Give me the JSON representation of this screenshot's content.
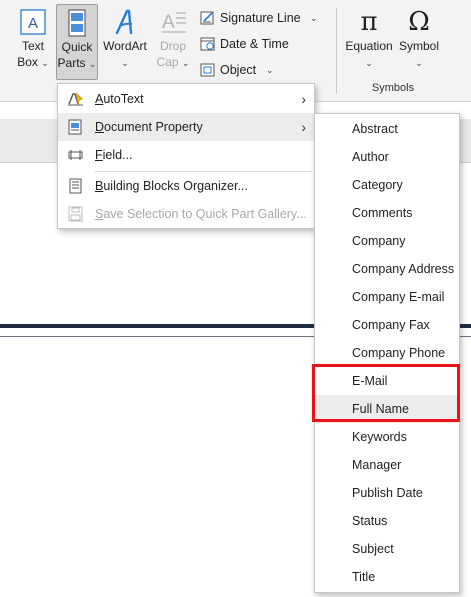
{
  "ribbon": {
    "text_box": {
      "line1": "Text",
      "line2": "Box"
    },
    "quick_parts": {
      "line1": "Quick",
      "line2": "Parts"
    },
    "wordart": {
      "label": "WordArt"
    },
    "drop_cap": {
      "line1": "Drop",
      "line2": "Cap"
    },
    "signature_line": "Signature Line",
    "date_time": "Date & Time",
    "object": "Object",
    "equation": "Equation",
    "symbol": "Symbol",
    "symbols_group": "Symbols",
    "chevron": "⌄",
    "equation_glyph": "π",
    "symbol_glyph": "Ω"
  },
  "quick_parts_menu": {
    "items": [
      {
        "label_u": "A",
        "label_rest": "utoText",
        "has_submenu": true,
        "enabled": true
      },
      {
        "label_u": "D",
        "label_rest": "ocument Property",
        "has_submenu": true,
        "enabled": true,
        "highlighted": true
      },
      {
        "label_u": "F",
        "label_rest": "ield...",
        "has_submenu": false,
        "enabled": true
      },
      {
        "label_u": "B",
        "label_rest": "uilding Blocks Organizer...",
        "has_submenu": false,
        "enabled": true
      },
      {
        "label_u": "S",
        "label_rest": "ave Selection to Quick Part Gallery...",
        "has_submenu": false,
        "enabled": false
      }
    ],
    "submenu_arrow": "›"
  },
  "document_property_menu": {
    "items": [
      "Abstract",
      "Author",
      "Category",
      "Comments",
      "Company",
      "Company Address",
      "Company E-mail",
      "Company Fax",
      "Company Phone",
      "E-Mail",
      "Full Name",
      "Keywords",
      "Manager",
      "Publish Date",
      "Status",
      "Subject",
      "Title"
    ],
    "hovered": "Full Name",
    "emphasized_items": [
      "E-Mail",
      "Full Name"
    ]
  },
  "colors": {
    "emphasis_box": "#e8141a",
    "wordart_blue": "#2b7cd3",
    "header_rule": "#1e2c45"
  }
}
